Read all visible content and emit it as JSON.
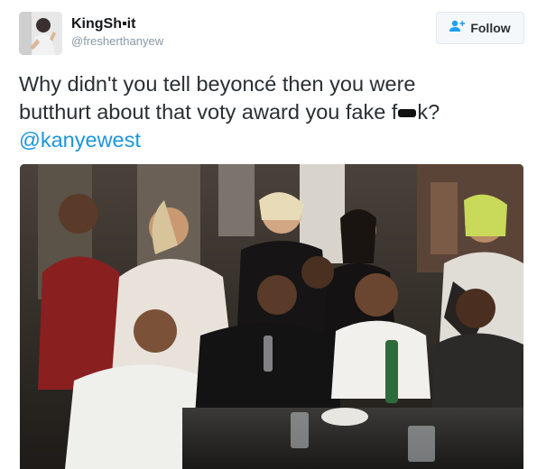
{
  "user": {
    "display_name": "KingSh▪it",
    "handle": "@fresherthanyew",
    "avatar_icon": "avatar-photo"
  },
  "follow_button": {
    "label": "Follow",
    "icon": "add-user-icon",
    "accent": "#1da1f2"
  },
  "tweet": {
    "line1": "Why didn't you tell beyoncé then you were",
    "line2_before": "butthurt about that voty award you fake f",
    "line2_after": "k?",
    "mention": "@kanyewest"
  },
  "colors": {
    "mention": "#1b95e0",
    "text": "#292f33",
    "handle": "#8899a6"
  }
}
